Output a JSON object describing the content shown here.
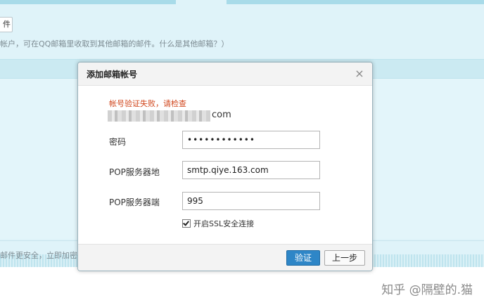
{
  "background": {
    "button_label": "件",
    "info_line": "帐户，可在QQ邮箱里收取到其他邮箱的邮件。什么是其他邮箱？）",
    "bottom_line": "邮件更安全，立即加密"
  },
  "dialog": {
    "title": "添加邮箱帐号",
    "close_label": "×",
    "error_message": "帐号验证失败，请检查",
    "account_domain": "com",
    "fields": {
      "password": {
        "label": "密码",
        "value": "••••••••••••"
      },
      "pop_server": {
        "label": "POP服务器地",
        "value": "smtp.qiye.163.com"
      },
      "pop_port": {
        "label": "POP服务器端",
        "value": "995"
      }
    },
    "ssl": {
      "label": "开启SSL安全连接",
      "checked": true
    },
    "buttons": {
      "verify": "验证",
      "previous": "上一步"
    }
  },
  "watermark": "知乎 @隔壁的.猫",
  "colors": {
    "accent": "#2e86c7",
    "error": "#d0451b",
    "background": "#dff3f9"
  }
}
